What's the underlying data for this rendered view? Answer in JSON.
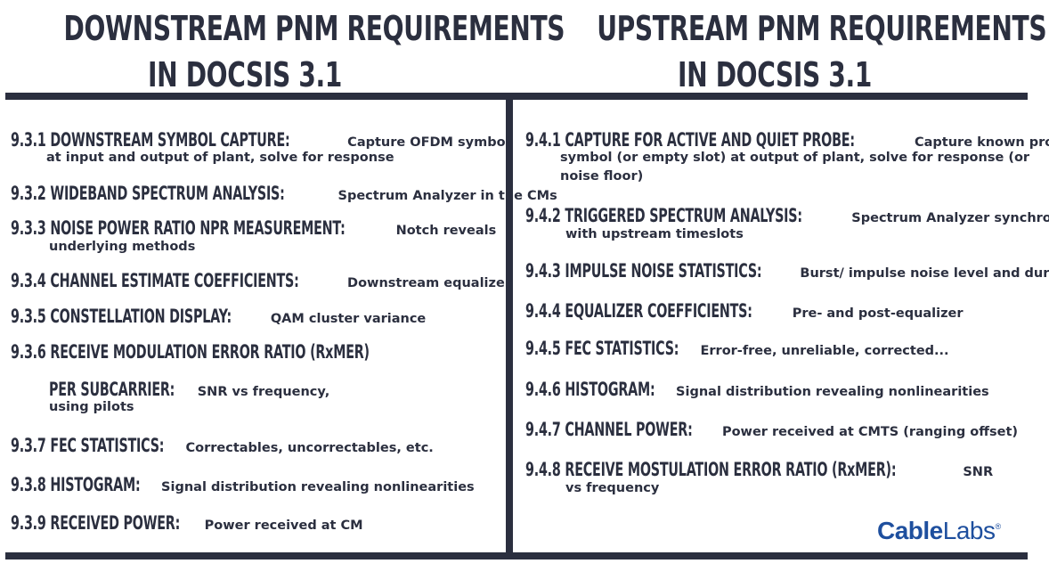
{
  "left": {
    "title": [
      "DOWNSTREAM PNM REQUIREMENTS",
      "IN DOCSIS 3.1"
    ],
    "items": [
      {
        "head": "9.3.1 DOWNSTREAM SYMBOL CAPTURE:",
        "desc": "Capture OFDM symbol",
        "cont": "at input and output of plant, solve for response"
      },
      {
        "head": "9.3.2 WIDEBAND SPECTRUM ANALYSIS:",
        "desc": "Spectrum Analyzer in the CMs"
      },
      {
        "head": "9.3.3 NOISE POWER RATIO NPR MEASUREMENT:",
        "desc": "Notch reveals",
        "cont": "underlying methods"
      },
      {
        "head": "9.3.4 CHANNEL ESTIMATE COEFFICIENTS:",
        "desc": "Downstream equalizer"
      },
      {
        "head": "9.3.5 CONSTELLATION DISPLAY:",
        "desc": "QAM cluster variance"
      },
      {
        "head": "9.3.6 RECEIVE MODULATION ERROR RATIO (RxMER)",
        "desc": ""
      },
      {
        "head": "PER SUBCARRIER:",
        "desc": "SNR vs frequency,",
        "cont": "using pilots"
      },
      {
        "head": "9.3.7 FEC STATISTICS:",
        "desc": "Correctables, uncorrectables, etc."
      },
      {
        "head": "9.3.8 HISTOGRAM:",
        "desc": "Signal distribution revealing nonlinearities"
      },
      {
        "head": "9.3.9 RECEIVED POWER:",
        "desc": "Power received at CM"
      }
    ]
  },
  "right": {
    "title": [
      "UPSTREAM PNM REQUIREMENTS",
      "IN DOCSIS 3.1"
    ],
    "items": [
      {
        "head": "9.4.1 CAPTURE FOR ACTIVE AND QUIET PROBE:",
        "desc": "Capture known probe",
        "cont": "symbol (or empty slot) at output of plant, solve for response (or",
        "cont2": "noise floor)"
      },
      {
        "head": "9.4.2 TRIGGERED SPECTRUM ANALYSIS:",
        "desc": "Spectrum Analyzer synchronized",
        "cont": "with upstream timeslots"
      },
      {
        "head": "9.4.3 IMPULSE NOISE STATISTICS:",
        "desc": "Burst/ impulse noise level and duration"
      },
      {
        "head": "9.4.4 EQUALIZER COEFFICIENTS:",
        "desc": "Pre- and post-equalizer"
      },
      {
        "head": "9.4.5 FEC STATISTICS:",
        "desc": "Error-free, unreliable, corrected..."
      },
      {
        "head": "9.4.6 HISTOGRAM:",
        "desc": "Signal distribution revealing nonlinearities"
      },
      {
        "head": "9.4.7 CHANNEL POWER:",
        "desc": "Power received at CMTS (ranging offset)"
      },
      {
        "head": "9.4.8 RECEIVE MOSTULATION ERROR RATIO (RxMER):",
        "desc": "SNR",
        "cont": "vs frequency"
      }
    ]
  },
  "logo": {
    "cable": "Cable",
    "labs": "Labs",
    "reg": "®"
  },
  "colors": {
    "text": "#2b2f3f",
    "rule": "#2b2f3f",
    "logo": "#1e4f9e"
  }
}
